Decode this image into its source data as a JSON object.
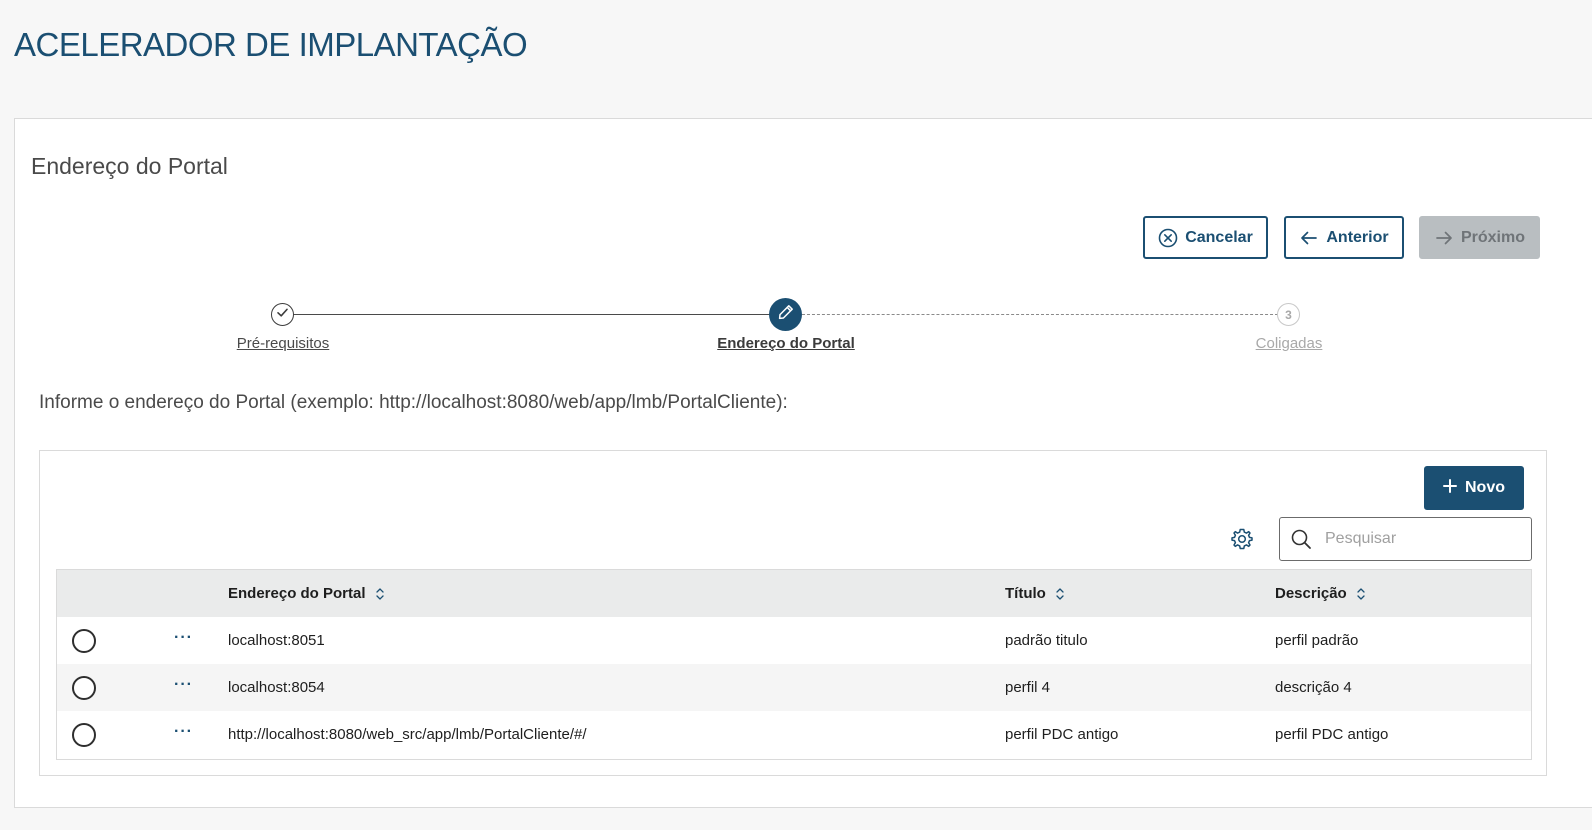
{
  "app": {
    "title": "ACELERADOR DE IMPLANTAÇÃO"
  },
  "card": {
    "title": "Endereço do Portal"
  },
  "actions": {
    "cancel_label": "Cancelar",
    "previous_label": "Anterior",
    "next_label": "Próximo"
  },
  "stepper": {
    "steps": [
      {
        "label": "Pré-requisitos",
        "state": "done"
      },
      {
        "label": "Endereço do Portal",
        "state": "active"
      },
      {
        "label": "Coligadas",
        "state": "pending",
        "number": "3"
      }
    ]
  },
  "instruction": "Informe o endereço do Portal (exemplo: http://localhost:8080/web/app/lmb/PortalCliente):",
  "toolbar": {
    "new_label": "Novo",
    "search_placeholder": "Pesquisar",
    "search_value": ""
  },
  "table": {
    "columns": [
      "Endereço do Portal",
      "Título",
      "Descrição"
    ],
    "rows": [
      {
        "address": "localhost:8051",
        "title": "padrão titulo",
        "description": "perfil padrão"
      },
      {
        "address": "localhost:8054",
        "title": "perfil 4",
        "description": "descrição 4"
      },
      {
        "address": "http://localhost:8080/web_src/app/lmb/PortalCliente/#/",
        "title": "perfil PDC antigo",
        "description": "perfil PDC antigo"
      }
    ],
    "row_actions_glyph": "···"
  },
  "colors": {
    "primary": "#1b4f72",
    "disabled": "#b9bec1",
    "header_bg": "#eaebeb",
    "page_bg": "#f7f7f7"
  },
  "icons": {
    "cancel": "circle-x-icon",
    "previous": "arrow-left-icon",
    "next": "arrow-right-icon",
    "step_done": "check-icon",
    "step_active": "pencil-icon",
    "new": "plus-icon",
    "settings": "gear-icon",
    "search": "search-icon",
    "sort": "sort-icon"
  }
}
